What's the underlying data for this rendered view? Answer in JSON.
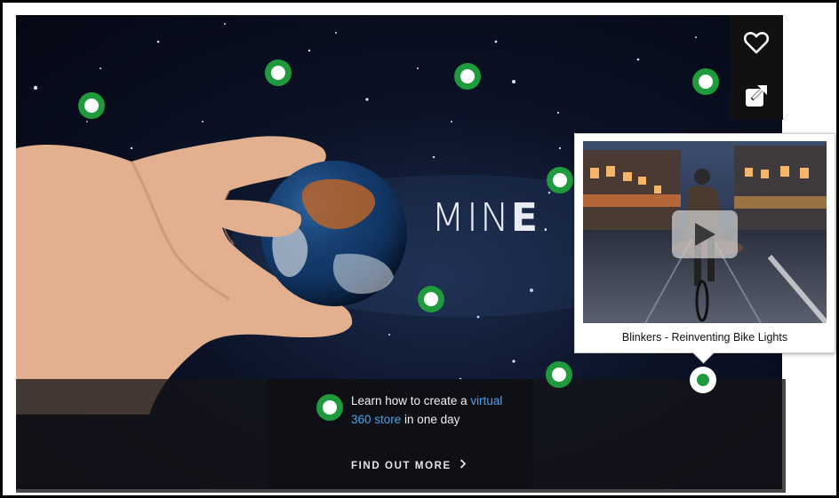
{
  "hero": {
    "brand_plain": "MIN",
    "brand_bold": "E",
    "brand_dot": "."
  },
  "actions": {
    "favorite_icon": "heart-icon",
    "share_icon": "share-icon"
  },
  "promo": {
    "line_before": "Learn how to create a ",
    "link_text": "virtual 360 store",
    "line_after": " in one day",
    "cta_label": "FIND OUT MORE",
    "cta_icon": "chevron-right-icon"
  },
  "popup": {
    "caption": "Blinkers - Reinventing Bike Lights",
    "play_icon": "play-icon"
  },
  "colors": {
    "hotspot": "#1f9a3c",
    "link": "#4aa3e8",
    "background": "#0b1226"
  }
}
